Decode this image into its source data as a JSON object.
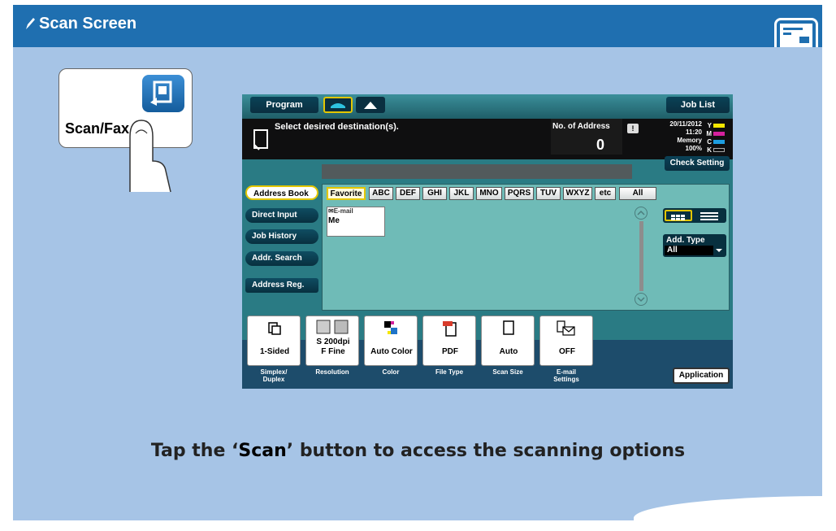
{
  "slide": {
    "title": "Scan Screen",
    "caption_prefix": "Tap the ‘",
    "caption_highlight": "Scan",
    "caption_suffix": "’ button to access the scanning options",
    "accent_color": "#1f6fb0",
    "body_color": "#a6c4e6"
  },
  "scanfax": {
    "label": "Scan/Fax"
  },
  "mfp": {
    "program_label": "Program",
    "job_list_label": "Job List",
    "message": "Select desired destination(s).",
    "no_of_address_label": "No. of Address",
    "no_of_address_value": "0",
    "date": "20/11/2012",
    "time": "11:20",
    "memory_label": "Memory",
    "memory_value": "100%",
    "check_setting_label": "Check Setting",
    "side_buttons": [
      {
        "label": "Address Book"
      },
      {
        "label": "Direct Input"
      },
      {
        "label": "Job History"
      },
      {
        "label": "Addr. Search"
      },
      {
        "label": "Address Reg."
      }
    ],
    "tabs": [
      {
        "label": "Favorite"
      },
      {
        "label": "ABC"
      },
      {
        "label": "DEF"
      },
      {
        "label": "GHI"
      },
      {
        "label": "JKL"
      },
      {
        "label": "MNO"
      },
      {
        "label": "PQRS"
      },
      {
        "label": "TUV"
      },
      {
        "label": "WXYZ"
      },
      {
        "label": "etc"
      },
      {
        "label": "All"
      }
    ],
    "entry": {
      "type": "E-mail",
      "name": "Me"
    },
    "add_type_label": "Add. Type",
    "add_type_value": "All",
    "options": [
      {
        "value": "1-Sided",
        "caption_line1": "Simplex/",
        "caption_line2": "Duplex",
        "icon": "duplex-icon"
      },
      {
        "value_line1": "S 200dpi",
        "value_line2": "F Fine",
        "caption_line1": "Resolution",
        "caption_line2": "",
        "icon": "resolution-icon"
      },
      {
        "value": "Auto Color",
        "caption_line1": "Color",
        "caption_line2": "",
        "icon": "color-icon"
      },
      {
        "value": "PDF",
        "caption_line1": "File Type",
        "caption_line2": "",
        "icon": "pdf-icon"
      },
      {
        "value": "Auto",
        "caption_line1": "Scan Size",
        "caption_line2": "",
        "icon": "page-icon"
      },
      {
        "value": "OFF",
        "caption_line1": "E-mail",
        "caption_line2": "Settings",
        "icon": "email-settings-icon"
      }
    ],
    "application_label": "Application",
    "cmyk_labels": [
      "Y",
      "M",
      "C",
      "K"
    ]
  }
}
